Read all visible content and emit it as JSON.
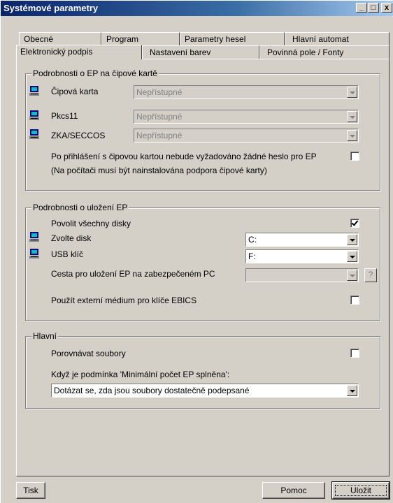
{
  "window": {
    "title": "Systémové parametry",
    "controls": [
      "_",
      "□",
      "x"
    ]
  },
  "tabs": {
    "row1": [
      "Obecné",
      "Program",
      "Parametry hesel",
      "Hlavní automat"
    ],
    "row2": [
      "Elektronický podpis",
      "Nastavení barev",
      "Povinná pole / Fonty"
    ],
    "active": "Elektronický podpis"
  },
  "card_group": {
    "title": "Podrobnosti o EP na čipové kartě",
    "rows": [
      {
        "label": "Čipová karta",
        "value": "Nepřístupné"
      },
      {
        "label": "Pkcs11",
        "value": "Nepřístupné"
      },
      {
        "label": "ZKA/SECCOS",
        "value": "Nepřístupné"
      }
    ],
    "no_password_label": "Po přihlášení s čipovou kartou nebude vyžadováno žádné heslo pro EP",
    "note": "(Na počítači musí být nainstalována podpora čipové karty)",
    "no_password_checked": false
  },
  "storage_group": {
    "title": "Podrobnosti o uložení EP",
    "allow_all_label": "Povolit všechny disky",
    "allow_all_checked": true,
    "disk_label": "Zvolte disk",
    "disk_value": "C:",
    "usb_label": "USB klíč",
    "usb_value": "F:",
    "path_label": "Cesta pro uložení EP na zabezpečeném PC",
    "path_value": "",
    "path_help": "?",
    "ebics_label": "Použít externí médium pro klíče EBICS",
    "ebics_checked": false
  },
  "main_group": {
    "title": "Hlavní",
    "compare_label": "Porovnávat soubory",
    "compare_checked": false,
    "condition_label": "Když je podmínka 'Minimální počet EP splněna':",
    "condition_value": "Dotázat se, zda jsou soubory dostatečně podepsané"
  },
  "footer": {
    "print_label": "Tisk",
    "help_label": "Pomoc",
    "save_label": "Uložit"
  },
  "colors": {
    "face": "#d4d0c8",
    "title_gradient_start": "#0a246a",
    "title_gradient_end": "#a6caf0"
  }
}
